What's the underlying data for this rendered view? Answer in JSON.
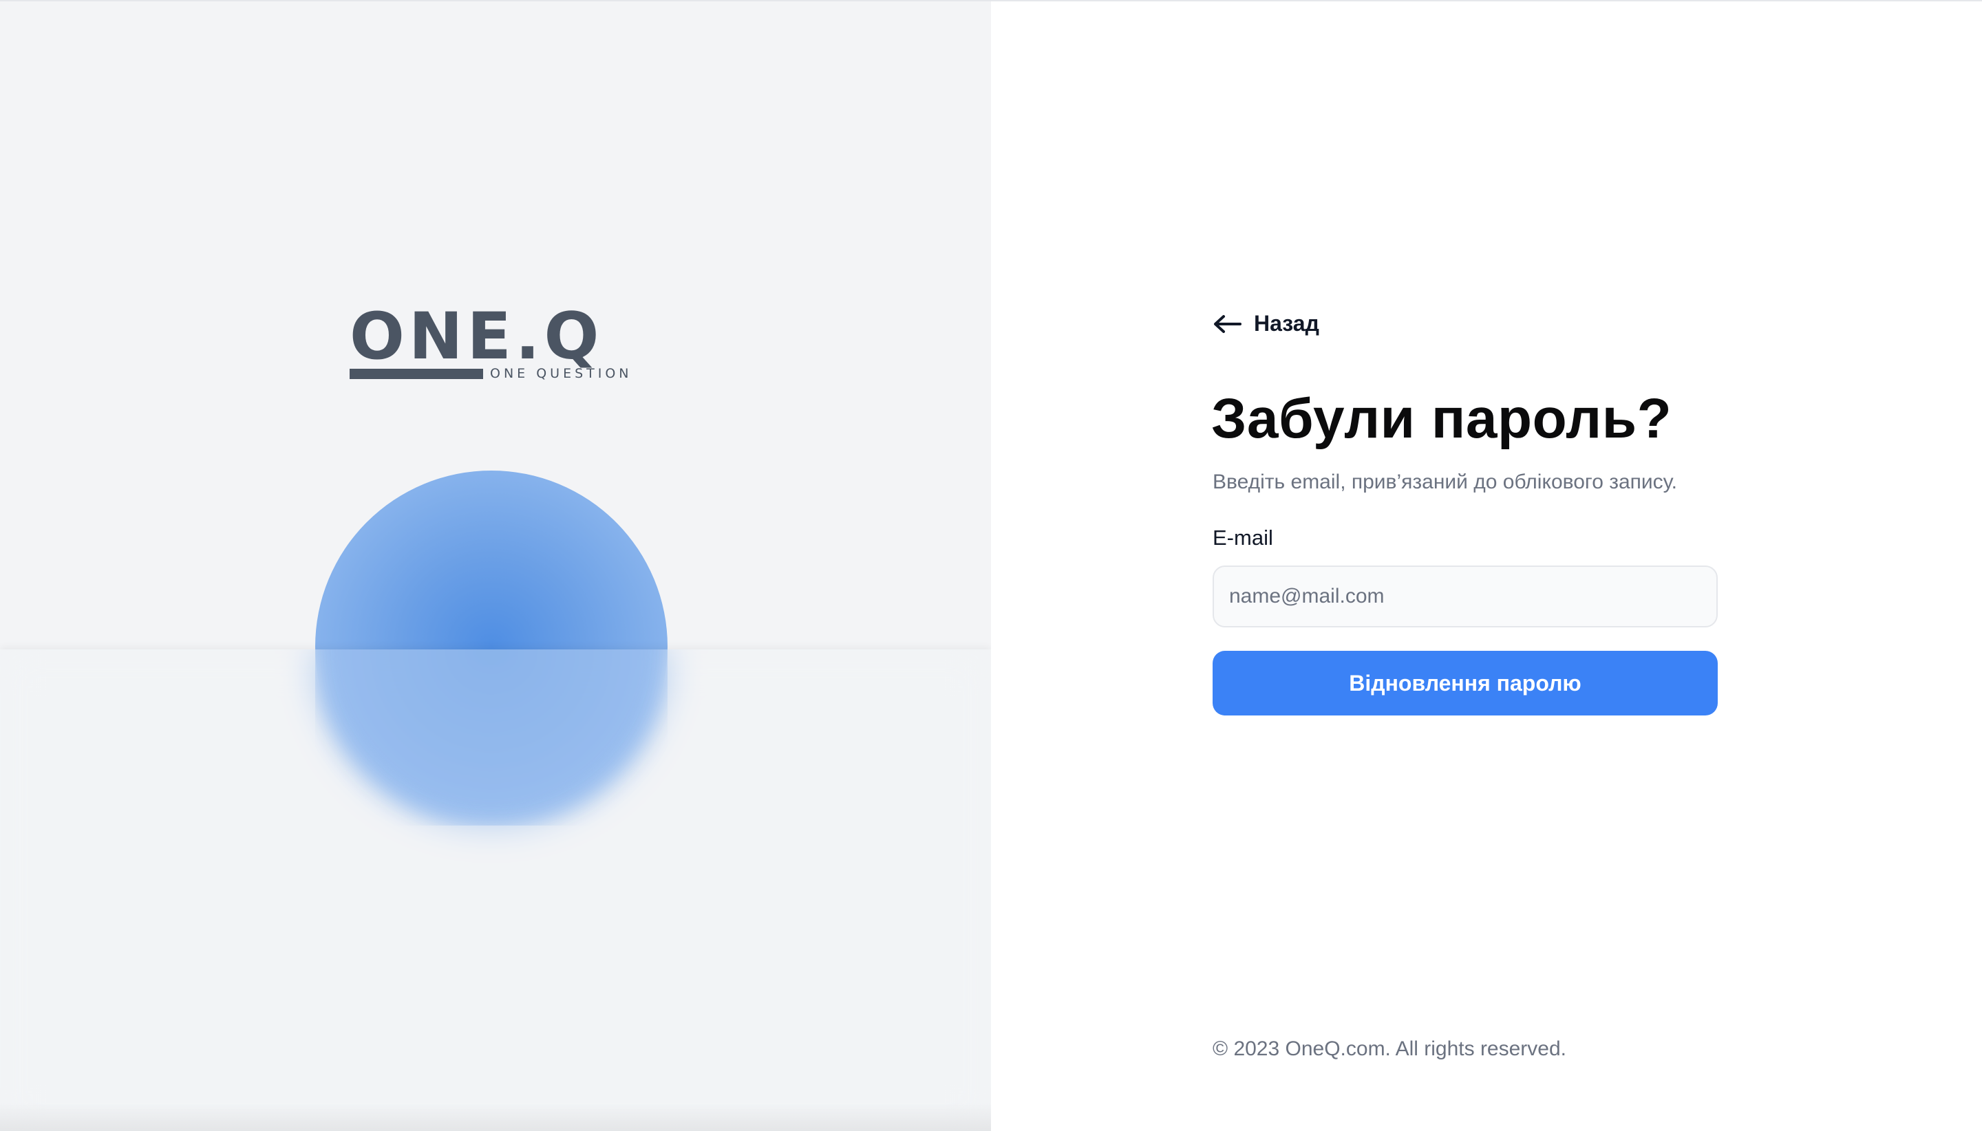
{
  "brand": {
    "logo_word": "ONE.Q",
    "logo_tagline": "ONE QUESTION"
  },
  "nav": {
    "back_label": "Назад"
  },
  "form": {
    "title": "Забули пароль?",
    "subtitle": "Введіть email, прив’язаний до облікового запису.",
    "email_label": "E-mail",
    "email_placeholder": "name@mail.com",
    "email_value": "",
    "submit_label": "Відновлення паролю"
  },
  "footer": {
    "copyright": "© 2023 OneQ.com. All rights reserved."
  },
  "colors": {
    "accent": "#3b82f6",
    "orb": "#4f8ee3",
    "left_panel_bg": "#f3f4f6",
    "logo": "#4b5563"
  },
  "icons": {
    "back": "arrow-left-icon"
  }
}
